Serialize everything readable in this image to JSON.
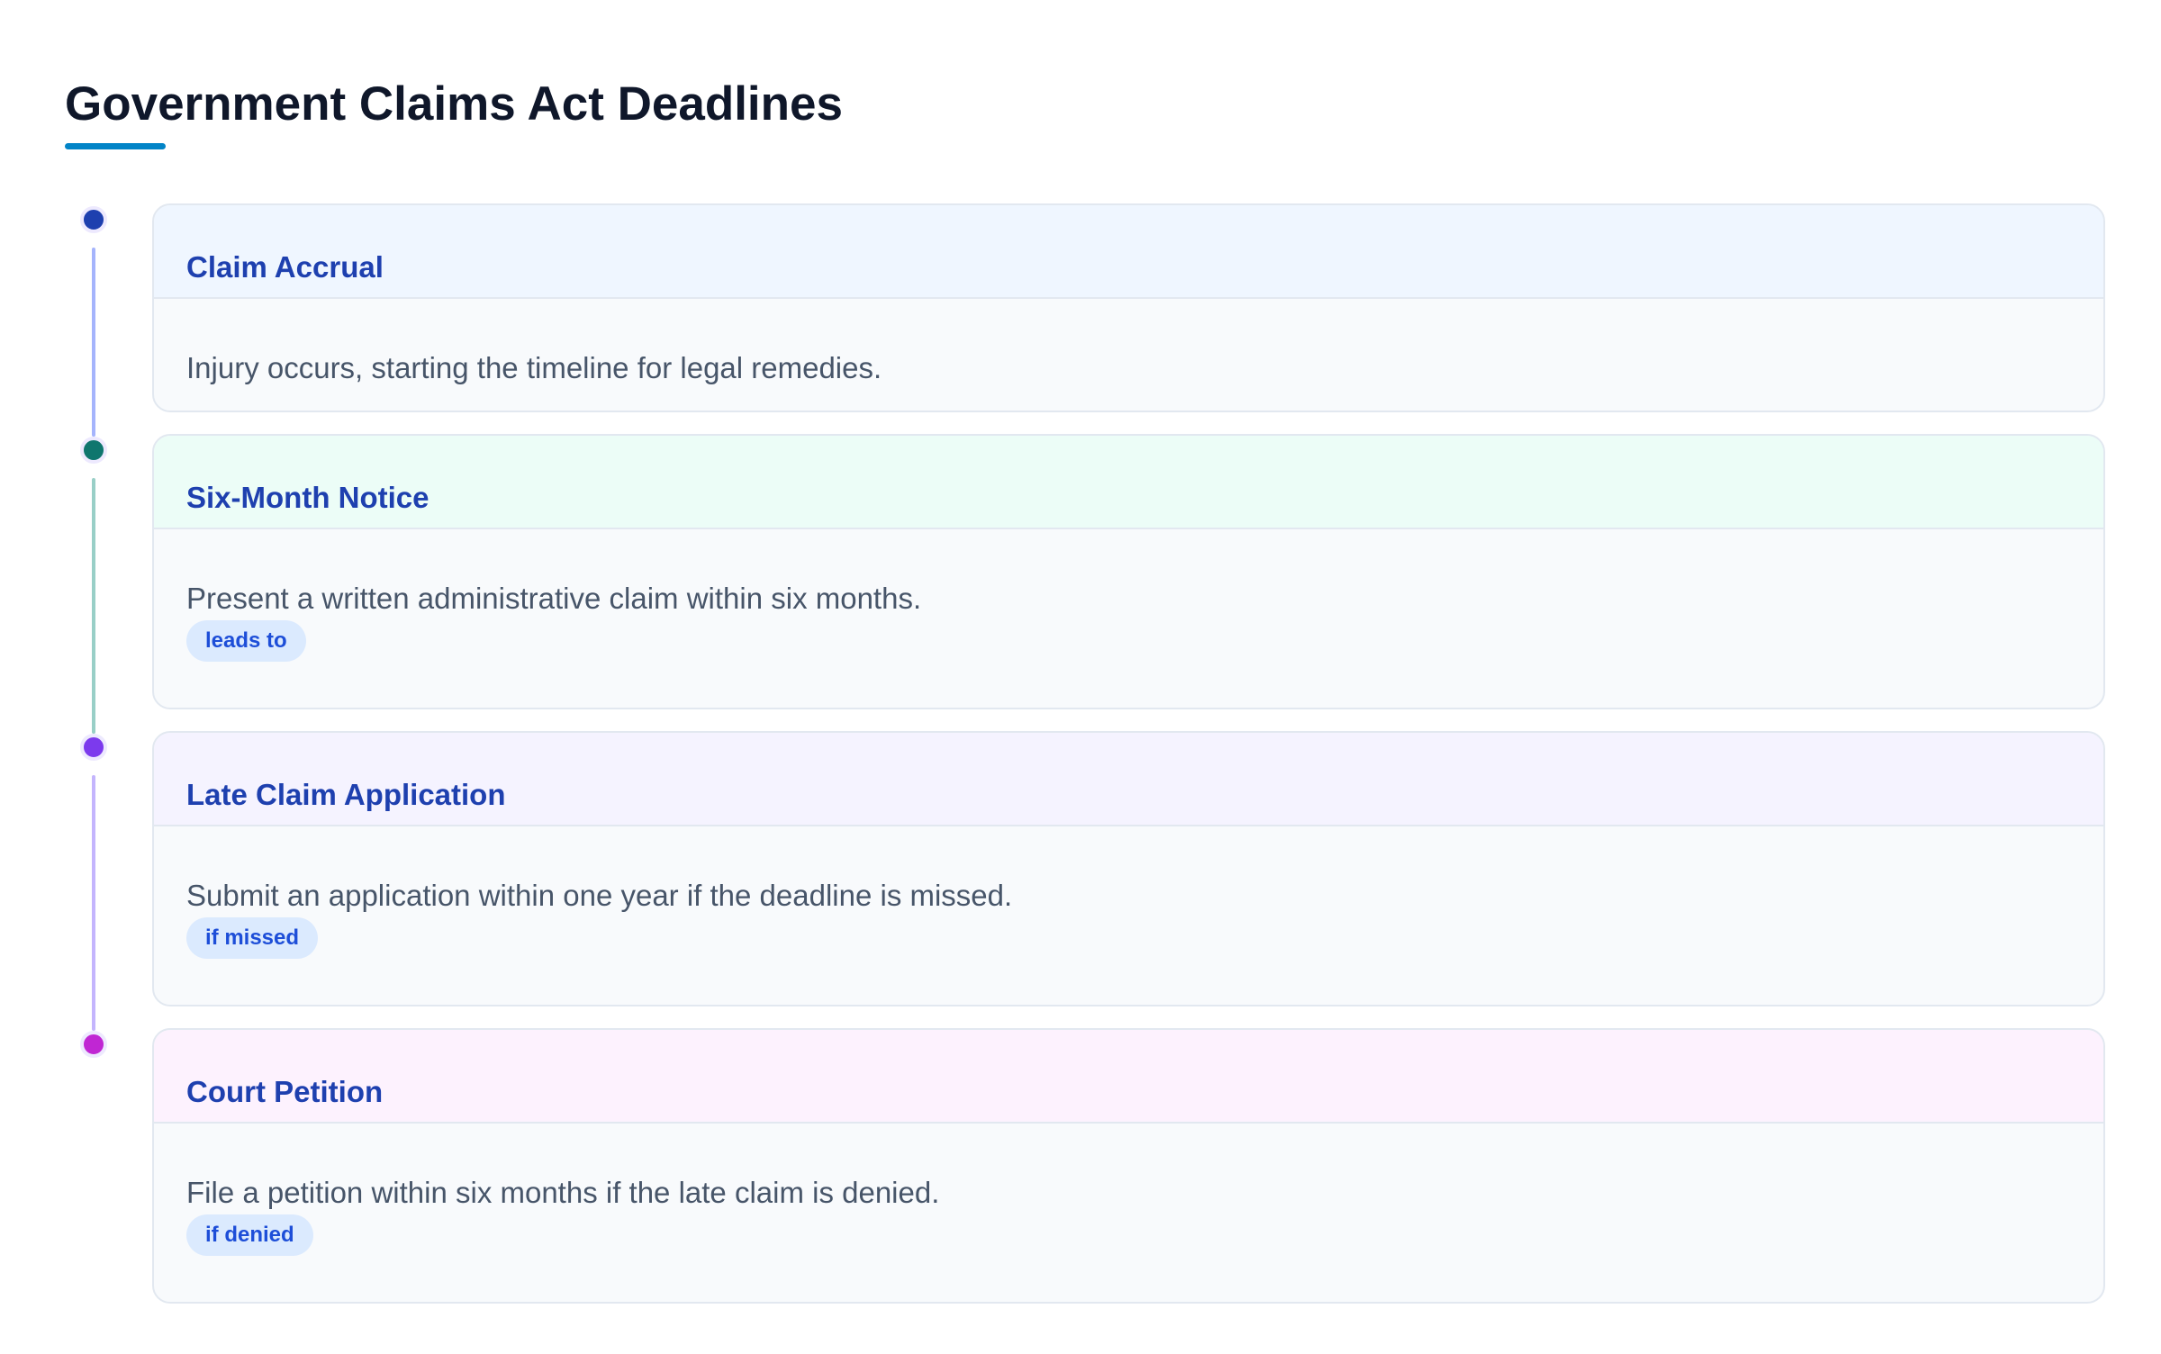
{
  "title": "Government Claims Act Deadlines",
  "accent_color": "#0284c7",
  "steps": [
    {
      "title": "Claim Accrual",
      "description": "Injury occurs, starting the timeline for legal remedies.",
      "tag": "",
      "dot_color": "#1e40af",
      "line_color": "#a5b4fc",
      "header_color": "#eff6ff"
    },
    {
      "title": "Six-Month Notice",
      "description": "Present a written administrative claim within six months.",
      "tag": "leads to",
      "dot_color": "#0f766e",
      "line_color": "#99cfc7",
      "header_color": "#ecfdf7"
    },
    {
      "title": "Late Claim Application",
      "description": "Submit an application within one year if the deadline is missed.",
      "tag": "if missed",
      "dot_color": "#7c3aed",
      "line_color": "#c4b5fd",
      "header_color": "#f5f3ff"
    },
    {
      "title": "Court Petition",
      "description": "File a petition within six months if the late claim is denied.",
      "tag": "if denied",
      "dot_color": "#c026d3",
      "line_color": "",
      "header_color": "#fdf2fe"
    }
  ]
}
